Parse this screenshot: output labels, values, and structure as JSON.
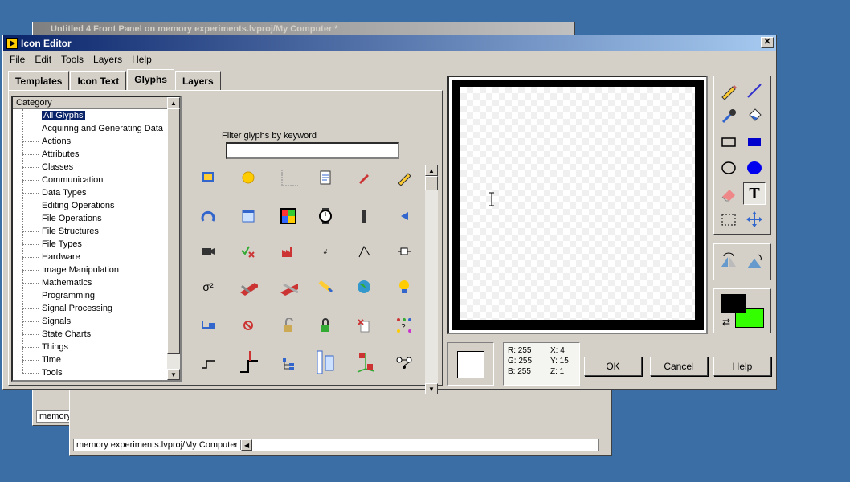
{
  "background_windows": {
    "front_panel_title": "Untitled 4 Front Panel on memory experiments.lvproj/My Computer *",
    "status1": "memory experiments.lvproj/My Computer",
    "status2": "memory experiments.lvproj/My Computer"
  },
  "dialog": {
    "title": "Icon Editor",
    "close_label": "✕"
  },
  "menu": [
    "File",
    "Edit",
    "Tools",
    "Layers",
    "Help"
  ],
  "tabs": [
    {
      "label": "Templates",
      "active": false
    },
    {
      "label": "Icon Text",
      "active": false
    },
    {
      "label": "Glyphs",
      "active": true
    },
    {
      "label": "Layers",
      "active": false
    }
  ],
  "category": {
    "header": "Category",
    "items": [
      "All Glyphs",
      "Acquiring and Generating Data",
      "Actions",
      "Attributes",
      "Classes",
      "Communication",
      "Data Types",
      "Editing Operations",
      "File Operations",
      "File Structures",
      "File Types",
      "Hardware",
      "Image Manipulation",
      "Mathematics",
      "Programming",
      "Signal Processing",
      "Signals",
      "State Charts",
      "Things",
      "Time",
      "Tools"
    ],
    "selected": "All Glyphs"
  },
  "filter": {
    "label": "Filter glyphs by keyword",
    "value": ""
  },
  "colors": {
    "foreground": "#000000",
    "background": "#33ff00",
    "accent": "#0a246a"
  },
  "info": {
    "r": "R: 255",
    "g": "G: 255",
    "b": "B: 255",
    "x": "X: 4",
    "y": "Y: 15",
    "z": "Z: 1"
  },
  "buttons": {
    "ok": "OK",
    "cancel": "Cancel",
    "help": "Help"
  },
  "tools": [
    "pencil-icon",
    "line-icon",
    "dropper-icon",
    "fill-icon",
    "rectangle-icon",
    "filled-rectangle-icon",
    "ellipse-icon",
    "filled-ellipse-icon",
    "eraser-icon",
    "text-icon",
    "selection-icon",
    "move-icon"
  ]
}
